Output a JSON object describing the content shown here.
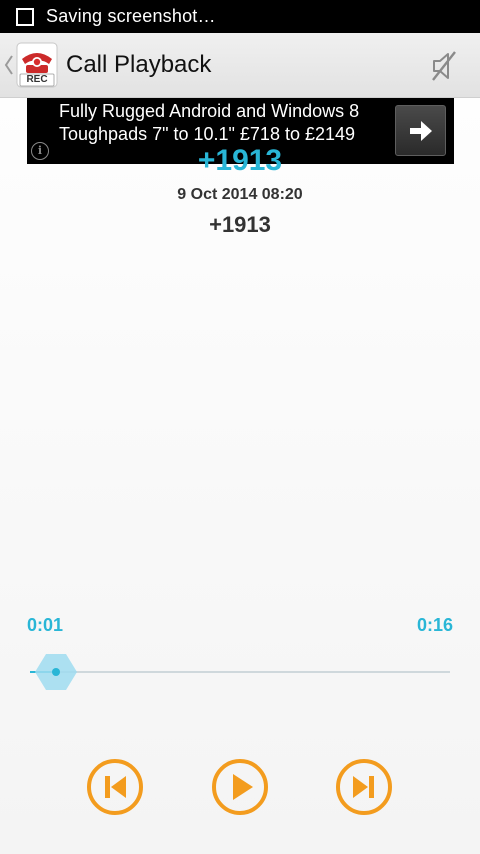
{
  "status_bar": {
    "text": "Saving screenshot…"
  },
  "action_bar": {
    "title": "Call Playback",
    "app_icon_badge": "REC",
    "icons": {
      "app": "rec-phone-icon",
      "up": "chevron-left-icon",
      "mute": "speaker-muted-icon"
    }
  },
  "ad": {
    "text": "Fully Rugged Android and Windows 8 Toughpads 7\" to 10.1\" £718 to £2149",
    "info_glyph": "i",
    "icons": {
      "info": "info-icon",
      "go": "arrow-right-icon"
    }
  },
  "call": {
    "caller_display": "+1913",
    "datetime": "9 Oct 2014  08:20",
    "number": "+1913"
  },
  "playback": {
    "elapsed": "0:01",
    "total": "0:16",
    "progress_fraction": 0.0625
  },
  "controls": {
    "icons": {
      "prev": "skip-previous-icon",
      "play": "play-icon",
      "next": "skip-next-icon"
    }
  },
  "colors": {
    "accent_teal": "#29b6d6",
    "control_orange": "#f39c1e",
    "thumb_blue": "#9fdcf0"
  }
}
